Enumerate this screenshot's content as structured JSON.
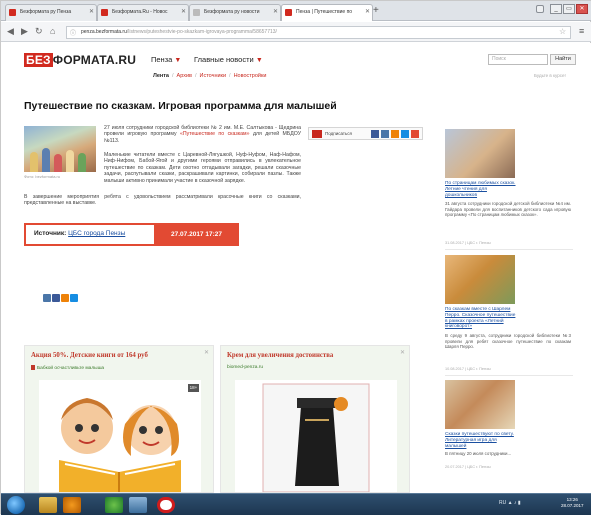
{
  "browser": {
    "tabs": [
      {
        "label": "Безформата ру Пенза",
        "active": false
      },
      {
        "label": "Безформата.Ru - Новос",
        "active": false
      },
      {
        "label": "Безформата ру новости",
        "active": false
      },
      {
        "label": "Пенза | Путешествие по",
        "active": true
      }
    ],
    "new_tab_symbol": "+",
    "url_host": "penza.bezformata.ru",
    "url_path": "/listnews/puteshestvie-po-skazkam-igrovaya-programma/58657713/",
    "window_buttons": {
      "minimize": "_",
      "maximize": "▭",
      "close": "✕"
    },
    "nav": {
      "back": "◀",
      "forward": "▶",
      "reload": "↻",
      "home": "⌂",
      "menu": "≡",
      "star": "☆"
    }
  },
  "site": {
    "logo_prefix": "БЕЗ",
    "logo_rest": "ФОРМАТА.RU",
    "city": "Пенза",
    "main_news": "Главные новости",
    "search_placeholder": "Поиск",
    "search_button": "Найти",
    "subnav": {
      "current": "Лента",
      "items": [
        "Архив",
        "Источники",
        "Новостройки"
      ]
    },
    "date_line": "Будьте в курсе!"
  },
  "article": {
    "title": "Путешествие по сказкам. Игровая программа для малышей",
    "photo_caption": "Фото: bezformata.ru",
    "p1_text": "27 июля сотрудники городской библиотеки № 2 им. М.Е. Салтыкова - Щедрина провели игровую программу ",
    "p1_link": "«Путешествие по сказкам»",
    "p1_tail": " для детей МБДОУ №113.",
    "p2": "Маленькие читатели вместе с Царевной-Лягушкой, Нуф-Нуфом, Наф-Нафом, Ниф-Нифом, Бабой-Ягой и другими героями отправились в увлекательное путешествие по сказкам. Дети охотно отгадывали загадки, решали сказочные задачи, распутывали сказки, раскрашивали картинки, собирали пазлы. Также малыши активно принимали участие в сказочной зарядке.",
    "p3": "В завершение мероприятия ребята с удовольствием рассматривали красочные книги со сказками, представленные на выставке.",
    "share_label": "Подписаться",
    "source_label": "Источник:",
    "source_name": "ЦБС города Пензы",
    "source_datetime": "27.07.2017  17:27"
  },
  "ads": [
    {
      "title": "Акция 50%. Детские книги от 164 руб",
      "subtitle": "Бабкой осчастливьте малыша",
      "counter": "18+",
      "close": "✕"
    },
    {
      "title": "Крем для увеличения достоинства",
      "subtitle": "biomed-penza.ru",
      "close": "✕"
    }
  ],
  "sidebar": [
    {
      "link": "По страницам любимых сказок. Летние чтения для дошкольников",
      "text": "31 августа сотрудники городской детской библиотеки №4 им. Гайдара провели для воспитанников детского сада игровую программу «По страницам любимых сказок».",
      "date": "31.08.2017 | ЦБС г. Пензы"
    },
    {
      "link": "По сказкам вместе с Шарлем Перро. Сказочное путешествие в рамках проекта «Летний книговорот»",
      "text": "В среду 9 августа, сотрудники городской библиотеки №3 провели для ребят сказочное путешествие по сказкам Шарля Перро.",
      "date": "10.08.2017 | ЦБС г. Пензы"
    },
    {
      "link": "Сказки путешествуют по свету. Литературная игра для малышей",
      "text": "В пятницу 20 июля сотрудники...",
      "date": "20.07.2017 | ЦБС г. Пензы"
    }
  ],
  "taskbar": {
    "clock_time": "13:26",
    "clock_date": "28.07.2017",
    "tray_lang": "RU"
  },
  "colors": {
    "brand_red": "#d12a1f",
    "accent": "#e24a33",
    "link": "#1a4fa0"
  }
}
